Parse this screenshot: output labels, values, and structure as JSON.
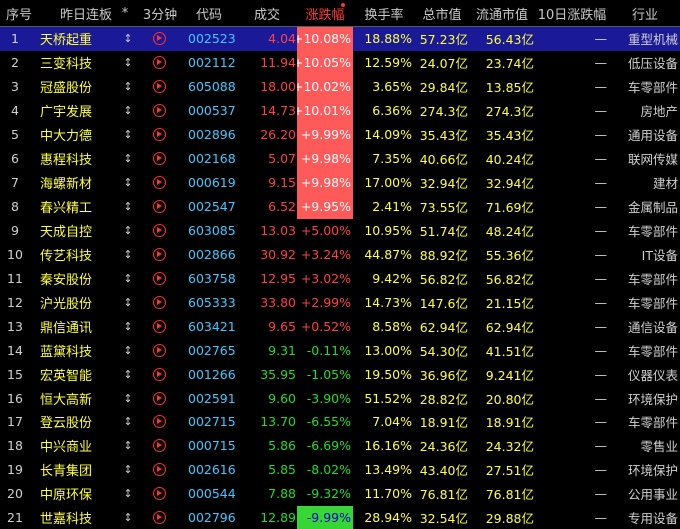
{
  "header": {
    "no": "序号",
    "name": "昨日连板",
    "mark": "*",
    "min": "3分钟",
    "code": "代码",
    "price": "成交",
    "pct": "涨跌幅",
    "turn": "换手率",
    "cap": "总市值",
    "fcap": "流通市值",
    "ten": "10日涨跌幅",
    "ind": "行业"
  },
  "rows": [
    {
      "no": "1",
      "name": "天桥起重",
      "code": "002523",
      "price": "4.04",
      "pct": "+10.08%",
      "turn": "18.88%",
      "cap": "57.23亿",
      "fcap": "56.43亿",
      "ten": "—",
      "ind": "重型机械"
    },
    {
      "no": "2",
      "name": "三变科技",
      "code": "002112",
      "price": "11.94",
      "pct": "+10.05%",
      "turn": "12.59%",
      "cap": "24.07亿",
      "fcap": "23.74亿",
      "ten": "—",
      "ind": "低压设备"
    },
    {
      "no": "3",
      "name": "冠盛股份",
      "code": "605088",
      "price": "18.00",
      "pct": "+10.02%",
      "turn": "3.65%",
      "cap": "29.84亿",
      "fcap": "13.85亿",
      "ten": "—",
      "ind": "车零部件"
    },
    {
      "no": "4",
      "name": "广宇发展",
      "code": "000537",
      "price": "14.73",
      "pct": "+10.01%",
      "turn": "6.36%",
      "cap": "274.3亿",
      "fcap": "274.3亿",
      "ten": "—",
      "ind": "房地产"
    },
    {
      "no": "5",
      "name": "中大力德",
      "code": "002896",
      "price": "26.20",
      "pct": "+9.99%",
      "turn": "14.09%",
      "cap": "35.43亿",
      "fcap": "35.43亿",
      "ten": "—",
      "ind": "通用设备"
    },
    {
      "no": "6",
      "name": "惠程科技",
      "code": "002168",
      "price": "5.07",
      "pct": "+9.98%",
      "turn": "7.35%",
      "cap": "40.66亿",
      "fcap": "40.24亿",
      "ten": "—",
      "ind": "联网传媒"
    },
    {
      "no": "7",
      "name": "海螺新材",
      "code": "000619",
      "price": "9.15",
      "pct": "+9.98%",
      "turn": "17.00%",
      "cap": "32.94亿",
      "fcap": "32.94亿",
      "ten": "—",
      "ind": "建材"
    },
    {
      "no": "8",
      "name": "春兴精工",
      "code": "002547",
      "price": "6.52",
      "pct": "+9.95%",
      "turn": "2.41%",
      "cap": "73.55亿",
      "fcap": "71.69亿",
      "ten": "—",
      "ind": "金属制品"
    },
    {
      "no": "9",
      "name": "天成自控",
      "code": "603085",
      "price": "13.03",
      "pct": "+5.00%",
      "turn": "10.95%",
      "cap": "51.74亿",
      "fcap": "48.24亿",
      "ten": "—",
      "ind": "车零部件"
    },
    {
      "no": "10",
      "name": "传艺科技",
      "code": "002866",
      "price": "30.92",
      "pct": "+3.24%",
      "turn": "44.87%",
      "cap": "88.92亿",
      "fcap": "55.36亿",
      "ten": "—",
      "ind": "IT设备"
    },
    {
      "no": "11",
      "name": "秦安股份",
      "code": "603758",
      "price": "12.95",
      "pct": "+3.02%",
      "turn": "9.42%",
      "cap": "56.82亿",
      "fcap": "56.82亿",
      "ten": "—",
      "ind": "车零部件"
    },
    {
      "no": "12",
      "name": "沪光股份",
      "code": "605333",
      "price": "33.80",
      "pct": "+2.99%",
      "turn": "14.73%",
      "cap": "147.6亿",
      "fcap": "21.15亿",
      "ten": "—",
      "ind": "车零部件"
    },
    {
      "no": "13",
      "name": "鼎信通讯",
      "code": "603421",
      "price": "9.65",
      "pct": "+0.52%",
      "turn": "8.58%",
      "cap": "62.94亿",
      "fcap": "62.94亿",
      "ten": "—",
      "ind": "通信设备"
    },
    {
      "no": "14",
      "name": "蓝黛科技",
      "code": "002765",
      "price": "9.31",
      "pct": "-0.11%",
      "turn": "13.00%",
      "cap": "54.30亿",
      "fcap": "41.51亿",
      "ten": "—",
      "ind": "车零部件"
    },
    {
      "no": "15",
      "name": "宏英智能",
      "code": "001266",
      "price": "35.95",
      "pct": "-1.05%",
      "turn": "19.50%",
      "cap": "36.96亿",
      "fcap": "9.241亿",
      "ten": "—",
      "ind": "仪器仪表"
    },
    {
      "no": "16",
      "name": "恒大高新",
      "code": "002591",
      "price": "9.60",
      "pct": "-3.90%",
      "turn": "51.52%",
      "cap": "28.82亿",
      "fcap": "20.80亿",
      "ten": "—",
      "ind": "环境保护"
    },
    {
      "no": "17",
      "name": "登云股份",
      "code": "002715",
      "price": "13.70",
      "pct": "-6.55%",
      "turn": "7.04%",
      "cap": "18.91亿",
      "fcap": "18.91亿",
      "ten": "—",
      "ind": "车零部件"
    },
    {
      "no": "18",
      "name": "中兴商业",
      "code": "000715",
      "price": "5.86",
      "pct": "-6.69%",
      "turn": "16.16%",
      "cap": "24.36亿",
      "fcap": "24.32亿",
      "ten": "—",
      "ind": "零售业"
    },
    {
      "no": "19",
      "name": "长青集团",
      "code": "002616",
      "price": "5.85",
      "pct": "-8.02%",
      "turn": "13.49%",
      "cap": "43.40亿",
      "fcap": "27.51亿",
      "ten": "—",
      "ind": "环境保护"
    },
    {
      "no": "20",
      "name": "中原环保",
      "code": "000544",
      "price": "7.88",
      "pct": "-9.32%",
      "turn": "11.70%",
      "cap": "76.81亿",
      "fcap": "76.81亿",
      "ten": "—",
      "ind": "公用事业"
    },
    {
      "no": "21",
      "name": "世嘉科技",
      "code": "002796",
      "price": "12.89",
      "pct": "-9.99%",
      "turn": "28.94%",
      "cap": "32.54亿",
      "fcap": "29.88亿",
      "ten": "—",
      "ind": "专用设备"
    }
  ]
}
